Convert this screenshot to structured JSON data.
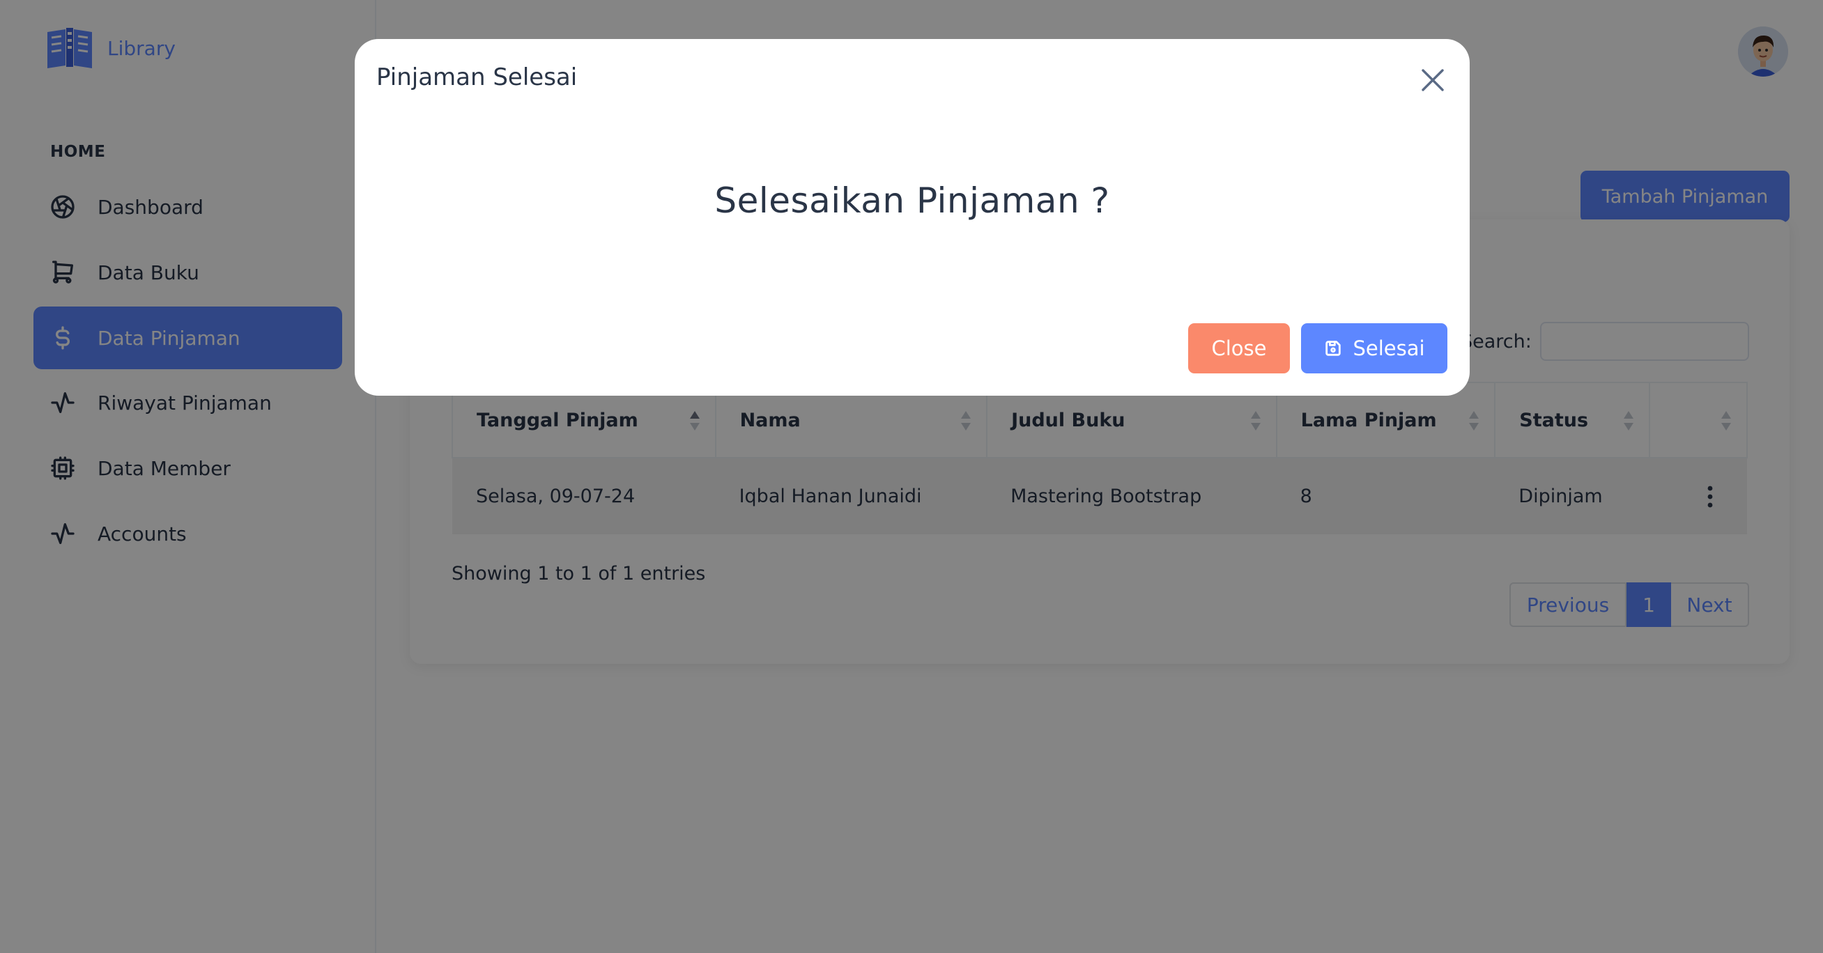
{
  "brand": {
    "name": "Library",
    "logo_icon": "book-library-icon"
  },
  "sidebar": {
    "heading": "HOME",
    "items": [
      {
        "label": "Dashboard",
        "icon": "aperture-icon",
        "active": false
      },
      {
        "label": "Data Buku",
        "icon": "cart-icon",
        "active": false
      },
      {
        "label": "Data Pinjaman",
        "icon": "dollar-icon",
        "active": true
      },
      {
        "label": "Riwayat Pinjaman",
        "icon": "activity-icon",
        "active": false
      },
      {
        "label": "Data Member",
        "icon": "cpu-icon",
        "active": false
      },
      {
        "label": "Accounts",
        "icon": "activity-icon",
        "active": false
      }
    ]
  },
  "header": {
    "avatar_icon": "user-avatar"
  },
  "main": {
    "add_button": "Tambah Pinjaman",
    "search_label": "Search:",
    "search_value": "",
    "table": {
      "columns": [
        "Tanggal Pinjam",
        "Nama",
        "Judul Buku",
        "Lama Pinjam",
        "Status",
        ""
      ],
      "rows": [
        [
          "Selasa, 09-07-24",
          "Iqbal Hanan Junaidi",
          "Mastering Bootstrap",
          "8",
          "Dipinjam"
        ]
      ]
    },
    "info": "Showing 1 to 1 of 1 entries",
    "pagination": {
      "previous": "Previous",
      "current": "1",
      "next": "Next"
    }
  },
  "modal": {
    "title": "Pinjaman Selesai",
    "message": "Selesaikan Pinjaman ?",
    "close_button": "Close",
    "confirm_button": "Selesai"
  },
  "colors": {
    "primary": "#5d87ff",
    "danger_soft": "#fa896b",
    "text": "#2a3547",
    "backdrop": "rgba(0,0,0,0.48)"
  }
}
